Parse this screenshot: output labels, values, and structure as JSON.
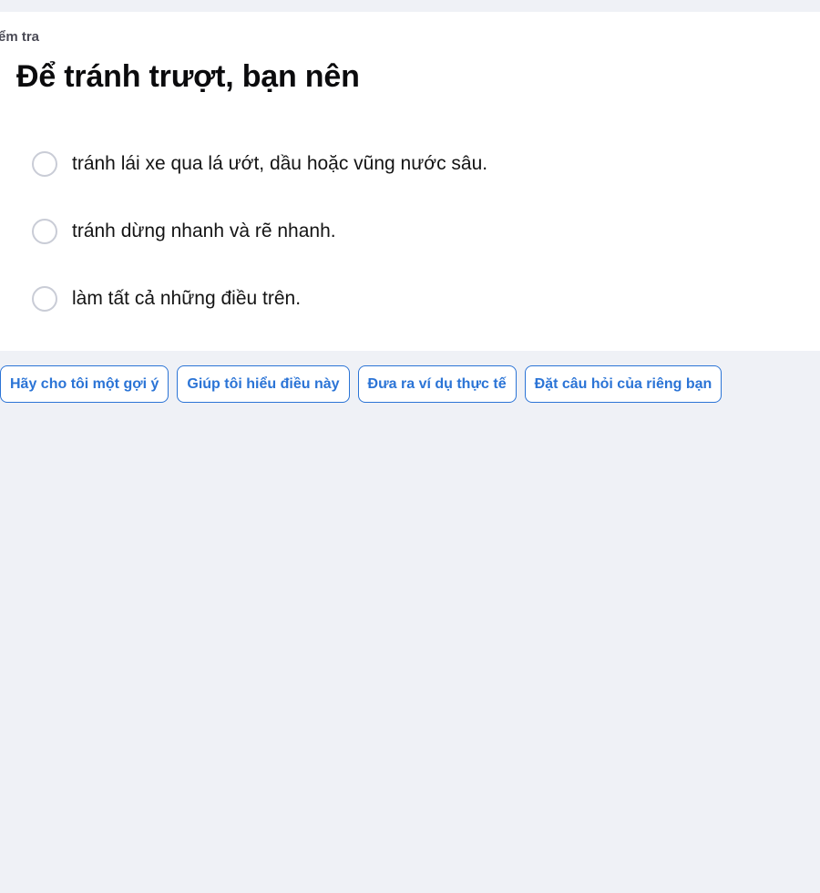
{
  "card": {
    "label": "Kiểm tra",
    "question": "Để tránh trượt, bạn nên",
    "options": [
      {
        "text": "tránh lái xe qua lá ướt, dầu hoặc vũng nước sâu."
      },
      {
        "text": "tránh dừng nhanh và rẽ nhanh."
      },
      {
        "text": "làm tất cả những điều trên."
      }
    ]
  },
  "suggestions": [
    {
      "label": "Hãy cho tôi một gợi ý"
    },
    {
      "label": "Giúp tôi hiểu điều này"
    },
    {
      "label": "Đưa ra ví dụ thực tế"
    },
    {
      "label": "Đặt câu hỏi của riêng bạn"
    }
  ],
  "colors": {
    "background": "#eff1f6",
    "card": "#ffffff",
    "accent": "#2b74d6",
    "radio_border": "#c9ccd6"
  }
}
